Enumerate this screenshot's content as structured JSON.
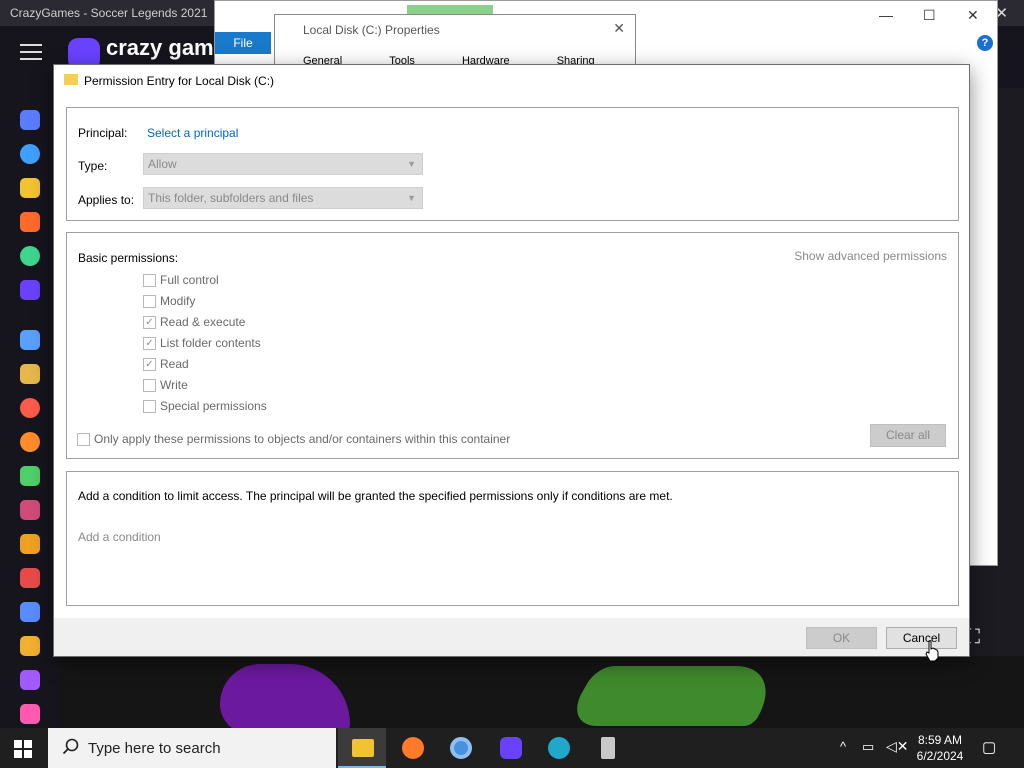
{
  "browser": {
    "tab_title": "CrazyGames - Soccer Legends 2021",
    "logo_text": "crazy games"
  },
  "explorer": {
    "file_tab": "File",
    "help": "?"
  },
  "properties": {
    "title": "Local Disk (C:) Properties",
    "tabs": [
      "General",
      "Tools",
      "Hardware",
      "Sharing"
    ]
  },
  "dialog": {
    "title": "Permission Entry for Local Disk (C:)",
    "principal_label": "Principal:",
    "principal_link": "Select a principal",
    "type_label": "Type:",
    "type_value": "Allow",
    "applies_label": "Applies to:",
    "applies_value": "This folder, subfolders and files",
    "basic_label": "Basic permissions:",
    "advanced_link": "Show advanced permissions",
    "permissions": [
      {
        "label": "Full control",
        "checked": false
      },
      {
        "label": "Modify",
        "checked": false
      },
      {
        "label": "Read & execute",
        "checked": true
      },
      {
        "label": "List folder contents",
        "checked": true
      },
      {
        "label": "Read",
        "checked": true
      },
      {
        "label": "Write",
        "checked": false
      },
      {
        "label": "Special permissions",
        "checked": false
      }
    ],
    "only_apply_label": "Only apply these permissions to objects and/or containers within this container",
    "clear_all": "Clear all",
    "condition_text": "Add a condition to limit access. The principal will be granted the specified permissions only if conditions are met.",
    "add_condition": "Add a condition",
    "ok": "OK",
    "cancel": "Cancel"
  },
  "taskbar": {
    "search_placeholder": "Type here to search",
    "time": "8:59 AM",
    "date": "6/2/2024"
  }
}
